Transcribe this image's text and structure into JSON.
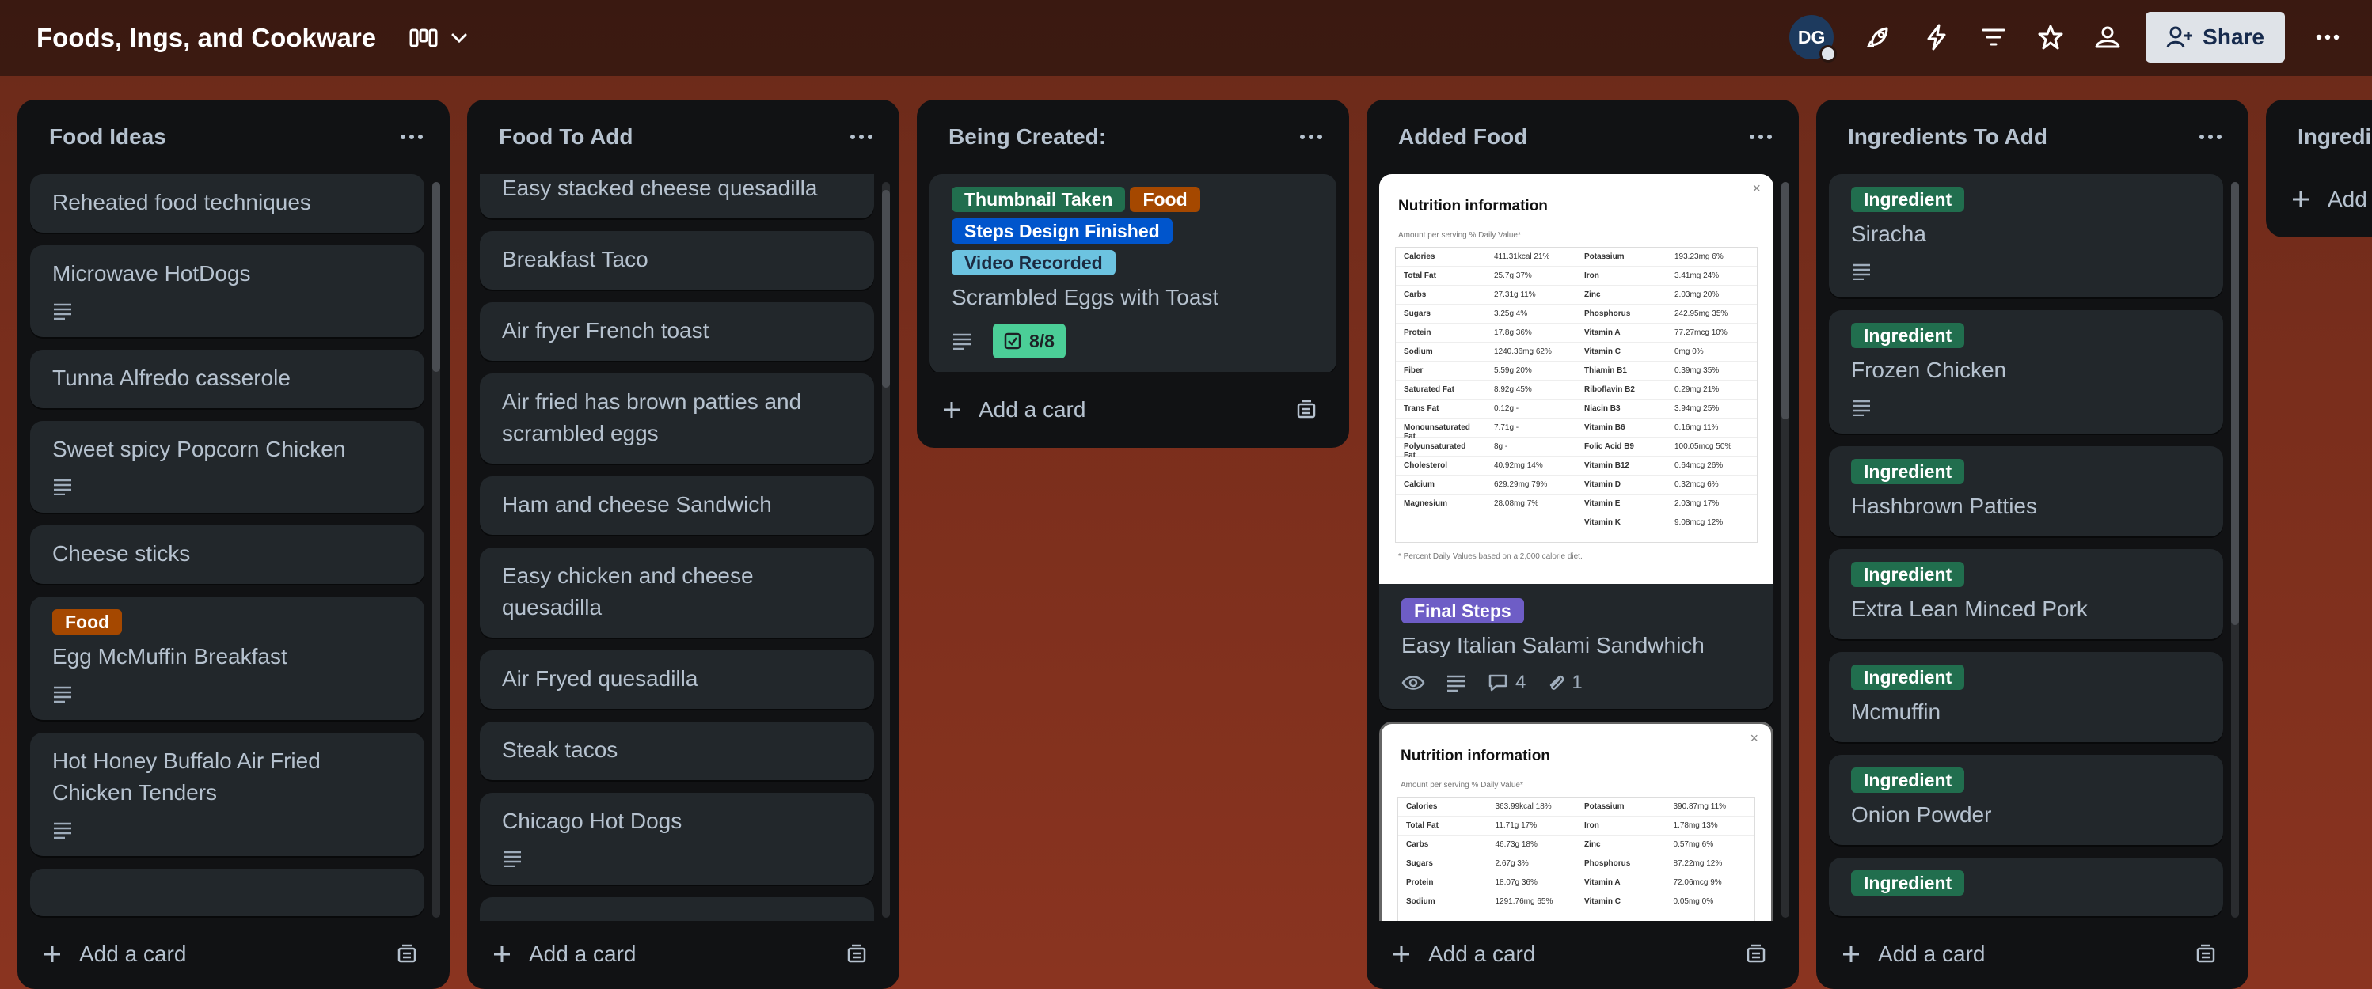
{
  "board": {
    "title": "Foods, Ings, and Cookware"
  },
  "header": {
    "avatar_initials": "DG",
    "share_label": "Share",
    "icons": [
      "board-view-icon",
      "chevron-down-icon",
      "rocket-icon",
      "lightning-icon",
      "filter-icon",
      "star-icon",
      "visibility-icon",
      "more-icon"
    ]
  },
  "lists": [
    {
      "title": "Food Ideas",
      "add_label": "Add a card",
      "cards": [
        {
          "title": "Reheated food techniques"
        },
        {
          "title": "Microwave HotDogs",
          "has_description": true
        },
        {
          "title": "Tunna Alfredo casserole"
        },
        {
          "title": "Sweet spicy Popcorn Chicken",
          "has_description": true
        },
        {
          "title": "Cheese sticks"
        },
        {
          "labels": [
            "Food"
          ],
          "title": "Egg McMuffin Breakfast",
          "has_description": true
        },
        {
          "title": "Hot Honey Buffalo Air Fried Chicken Tenders",
          "has_description": true
        }
      ]
    },
    {
      "title": "Food To Add",
      "add_label": "Add a card",
      "cards": [
        {
          "title": "Easy stacked cheese quesadilla"
        },
        {
          "title": "Breakfast Taco"
        },
        {
          "title": "Air fryer French toast"
        },
        {
          "title": "Air fried has brown patties and scrambled eggs"
        },
        {
          "title": "Ham and cheese Sandwich"
        },
        {
          "title": "Easy chicken and cheese quesadilla"
        },
        {
          "title": "Air Fryed quesadilla"
        },
        {
          "title": "Steak tacos"
        },
        {
          "title": "Chicago Hot Dogs",
          "has_description": true
        }
      ]
    },
    {
      "title": "Being Created:",
      "add_label": "Add a card",
      "cards": [
        {
          "labels": [
            "Thumbnail Taken",
            "Food",
            "Steps Design Finished",
            "Video Recorded"
          ],
          "title": "Scrambled Eggs with Toast",
          "has_description": true,
          "checklist": "8/8"
        }
      ]
    },
    {
      "title": "Added Food",
      "add_label": "Add a card",
      "cards": [
        {
          "cover_title": "Nutrition information",
          "cover_sub": "Amount per serving                      % Daily Value*",
          "cover_foot": "* Percent Daily Values based on a 2,000 calorie diet.",
          "labels": [
            "Final Steps"
          ],
          "title": "Easy Italian Salami Sandwhich",
          "comments": "4",
          "attachments": "1"
        },
        {
          "cover_title": "Nutrition information",
          "cover_sub": "Amount per serving                      % Daily Value*"
        }
      ]
    },
    {
      "title": "Ingredients To Add",
      "add_label": "Add a card",
      "cards": [
        {
          "labels": [
            "Ingredient"
          ],
          "title": "Siracha",
          "has_description": true
        },
        {
          "labels": [
            "Ingredient"
          ],
          "title": "Frozen Chicken",
          "has_description": true
        },
        {
          "labels": [
            "Ingredient"
          ],
          "title": "Hashbrown Patties"
        },
        {
          "labels": [
            "Ingredient"
          ],
          "title": "Extra Lean Minced Pork"
        },
        {
          "labels": [
            "Ingredient"
          ],
          "title": "Mcmuffin"
        },
        {
          "labels": [
            "Ingredient"
          ],
          "title": "Onion Powder"
        },
        {
          "labels": [
            "Ingredient"
          ]
        }
      ]
    },
    {
      "title": "Ingredi",
      "add_label": "Add"
    }
  ],
  "nutrition_rows_1": [
    [
      "Calories",
      "411.31kcal 21%",
      "Potassium",
      "193.23mg 6%"
    ],
    [
      "Total Fat",
      "25.7g 37%",
      "Iron",
      "3.41mg 24%"
    ],
    [
      "Carbs",
      "27.31g 11%",
      "Zinc",
      "2.03mg 20%"
    ],
    [
      "Sugars",
      "3.25g 4%",
      "Phosphorus",
      "242.95mg 35%"
    ],
    [
      "Protein",
      "17.8g 36%",
      "Vitamin A",
      "77.27mcg 10%"
    ],
    [
      "Sodium",
      "1240.36mg 62%",
      "Vitamin C",
      "0mg 0%"
    ],
    [
      "Fiber",
      "5.59g 20%",
      "Thiamin B1",
      "0.39mg 35%"
    ],
    [
      "Saturated Fat",
      "8.92g 45%",
      "Riboflavin B2",
      "0.29mg 21%"
    ],
    [
      "Trans Fat",
      "0.12g -",
      "Niacin B3",
      "3.94mg 25%"
    ],
    [
      "Monounsaturated Fat",
      "7.71g -",
      "Vitamin B6",
      "0.16mg 11%"
    ],
    [
      "Polyunsaturated Fat",
      "8g -",
      "Folic Acid B9",
      "100.05mcg 50%"
    ],
    [
      "Cholesterol",
      "40.92mg 14%",
      "Vitamin B12",
      "0.64mcg 26%"
    ],
    [
      "Calcium",
      "629.29mg 79%",
      "Vitamin D",
      "0.32mcg 6%"
    ],
    [
      "Magnesium",
      "28.08mg 7%",
      "Vitamin E",
      "2.03mg 17%"
    ],
    [
      "",
      "",
      "Vitamin K",
      "9.08mcg 12%"
    ]
  ],
  "nutrition_rows_2": [
    [
      "Calories",
      "363.99kcal 18%",
      "Potassium",
      "390.87mg 11%"
    ],
    [
      "Total Fat",
      "11.71g 17%",
      "Iron",
      "1.78mg 13%"
    ],
    [
      "Carbs",
      "46.73g 18%",
      "Zinc",
      "0.57mg 6%"
    ],
    [
      "Sugars",
      "2.67g 3%",
      "Phosphorus",
      "87.22mg 12%"
    ],
    [
      "Protein",
      "18.07g 36%",
      "Vitamin A",
      "72.06mcg 9%"
    ],
    [
      "Sodium",
      "1291.76mg 65%",
      "Vitamin C",
      "0.05mg 0%"
    ]
  ]
}
